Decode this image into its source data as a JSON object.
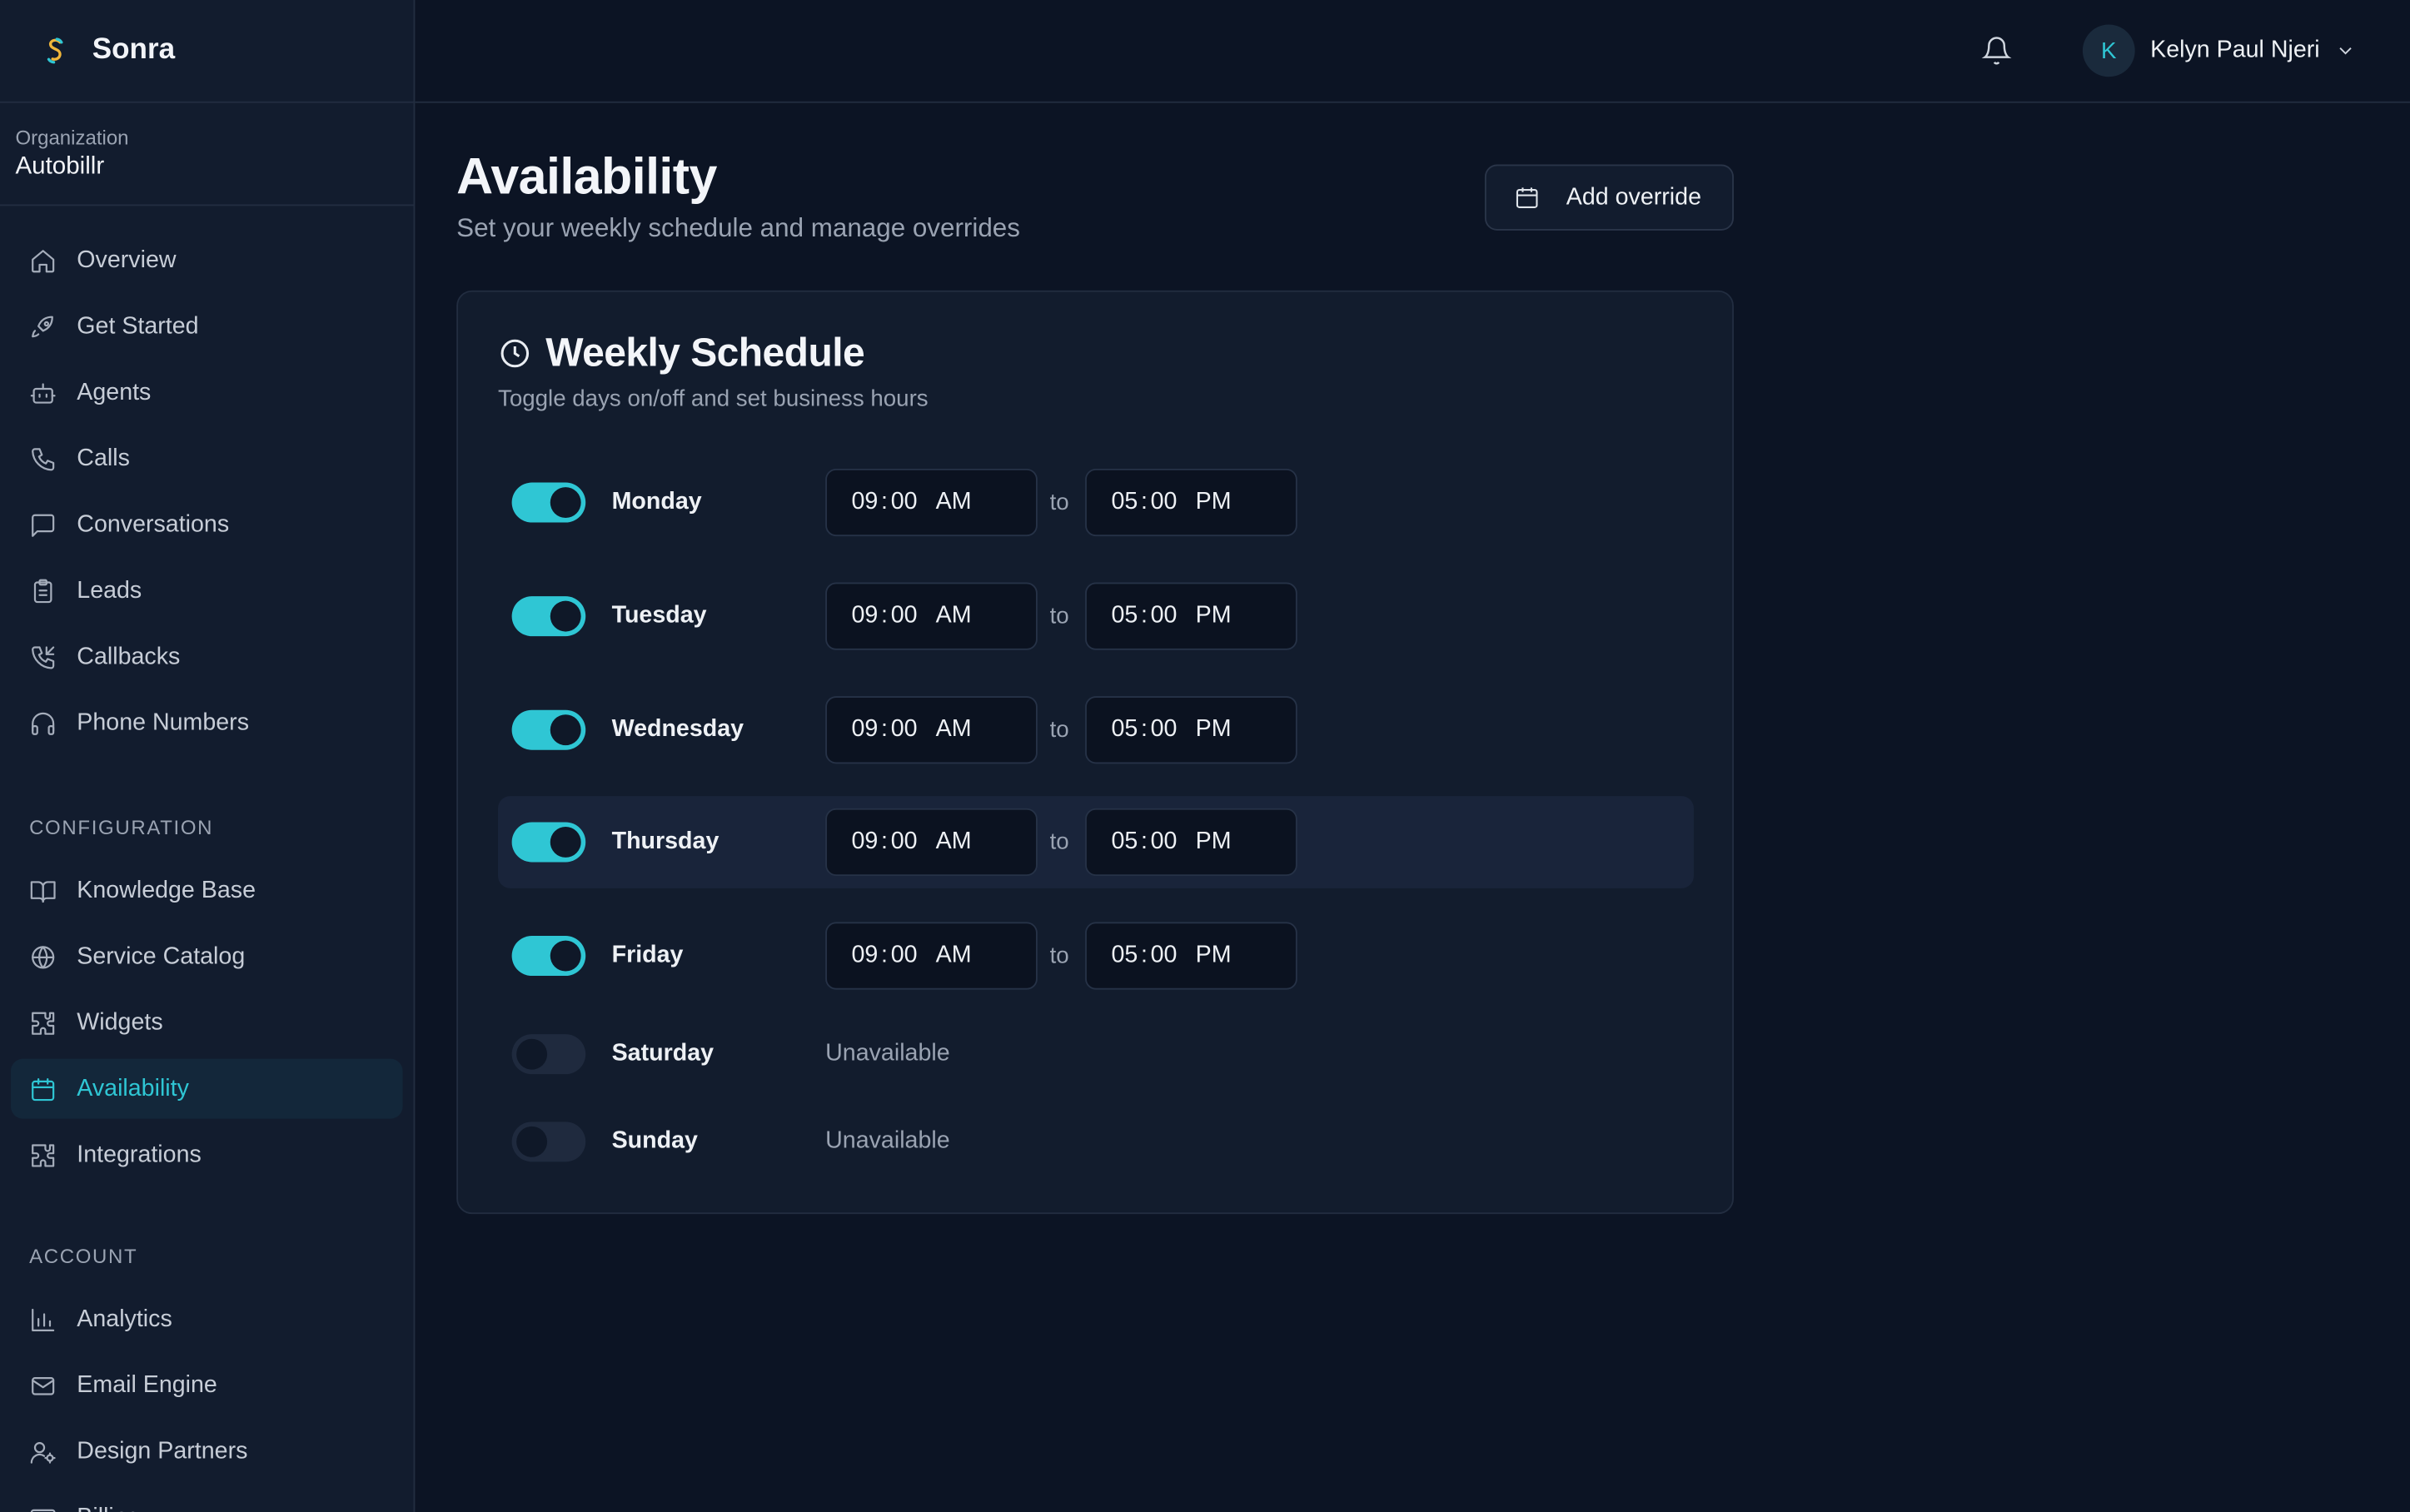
{
  "brand": {
    "name": "Sonra",
    "accent": "#2fc6d4"
  },
  "org": {
    "label": "Organization",
    "name": "Autobillr"
  },
  "nav": {
    "main": [
      {
        "label": "Overview",
        "icon": "home-icon"
      },
      {
        "label": "Get Started",
        "icon": "rocket-icon"
      },
      {
        "label": "Agents",
        "icon": "bot-icon"
      },
      {
        "label": "Calls",
        "icon": "phone-icon"
      },
      {
        "label": "Conversations",
        "icon": "message-icon"
      },
      {
        "label": "Leads",
        "icon": "clipboard-icon"
      },
      {
        "label": "Callbacks",
        "icon": "phone-callback-icon"
      },
      {
        "label": "Phone Numbers",
        "icon": "headphones-icon"
      }
    ],
    "config_label": "CONFIGURATION",
    "config": [
      {
        "label": "Knowledge Base",
        "icon": "book-icon"
      },
      {
        "label": "Service Catalog",
        "icon": "globe-icon"
      },
      {
        "label": "Widgets",
        "icon": "puzzle-icon"
      },
      {
        "label": "Availability",
        "icon": "calendar-icon",
        "active": true
      },
      {
        "label": "Integrations",
        "icon": "puzzle-icon"
      }
    ],
    "account_label": "ACCOUNT",
    "account": [
      {
        "label": "Analytics",
        "icon": "bar-chart-icon"
      },
      {
        "label": "Email Engine",
        "icon": "mail-icon"
      },
      {
        "label": "Design Partners",
        "icon": "user-cog-icon"
      },
      {
        "label": "Billing",
        "icon": "credit-card-icon"
      }
    ]
  },
  "topbar": {
    "user_initial": "K",
    "user_name": "Kelyn Paul Njeri"
  },
  "page": {
    "title": "Availability",
    "subtitle": "Set your weekly schedule and manage overrides",
    "add_override": "Add override"
  },
  "schedule": {
    "title": "Weekly Schedule",
    "description": "Toggle days on/off and set business hours",
    "to_label": "to",
    "unavailable_label": "Unavailable",
    "days": [
      {
        "day": "Monday",
        "enabled": true,
        "start": {
          "h": "09",
          "m": "00",
          "ampm": "AM"
        },
        "end": {
          "h": "05",
          "m": "00",
          "ampm": "PM"
        }
      },
      {
        "day": "Tuesday",
        "enabled": true,
        "start": {
          "h": "09",
          "m": "00",
          "ampm": "AM"
        },
        "end": {
          "h": "05",
          "m": "00",
          "ampm": "PM"
        }
      },
      {
        "day": "Wednesday",
        "enabled": true,
        "start": {
          "h": "09",
          "m": "00",
          "ampm": "AM"
        },
        "end": {
          "h": "05",
          "m": "00",
          "ampm": "PM"
        }
      },
      {
        "day": "Thursday",
        "enabled": true,
        "start": {
          "h": "09",
          "m": "00",
          "ampm": "AM"
        },
        "end": {
          "h": "05",
          "m": "00",
          "ampm": "PM"
        }
      },
      {
        "day": "Friday",
        "enabled": true,
        "start": {
          "h": "09",
          "m": "00",
          "ampm": "AM"
        },
        "end": {
          "h": "05",
          "m": "00",
          "ampm": "PM"
        }
      },
      {
        "day": "Saturday",
        "enabled": false
      },
      {
        "day": "Sunday",
        "enabled": false
      }
    ]
  }
}
